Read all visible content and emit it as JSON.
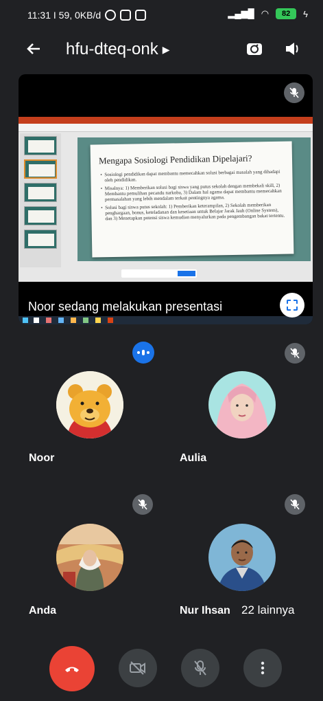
{
  "status_bar": {
    "time_info": "11:31 I 59, 0KB/d",
    "battery": "82",
    "icons": [
      "whatsapp-icon",
      "instagram-icon",
      "shop-icon",
      "signal-icon",
      "wifi-icon",
      "battery-icon",
      "charging-icon"
    ]
  },
  "header": {
    "meeting_code": "hfu-dteq-onk",
    "icons": [
      "back-arrow-icon",
      "chevron-right-icon",
      "switch-camera-icon",
      "speaker-icon"
    ]
  },
  "presentation": {
    "caption": "Noor sedang melakukan presentasi",
    "slide": {
      "title": "Mengapa Sosiologi Pendidikan Dipelajari?",
      "bullets": [
        "Sosiologi pendidikan dapat membantu memecahkan solusi berbagai masalah yang dihadapi oleh pendidikan.",
        "Misalnya: 1) Memberikan solusi bagi siswa yang putus sekolah dengan membekali skill, 2) Membantu pemulihan pecandu narkoba, 3) Dalam hal agama dapat membantu memecahkan permasalahan yang lebih mendalam terkait pentingnya agama.",
        "Solusi bagi siswa putus sekolah: 1) Pemberikan keterampilan, 2) Sekolah memberikan penghargaan, bonus, keteladanan dan kesetiaan untuk Belajar Jarak Jauh (Online System), dan 3) Menetapkan potensi siswa kemudian menyalurkan pada pengembangan bakat tertentu."
      ]
    }
  },
  "participants": [
    {
      "name": "Noor",
      "speaking": true,
      "muted": false,
      "avatar": "winnie-the-pooh"
    },
    {
      "name": "Aulia",
      "speaking": false,
      "muted": true,
      "avatar": "woman-pink-hijab"
    },
    {
      "name": "Anda",
      "speaking": false,
      "muted": true,
      "avatar": "woman-hijab-mall"
    },
    {
      "name": "Nur Ihsan",
      "speaking": false,
      "muted": true,
      "avatar": "man-blue-shirt"
    }
  ],
  "more_participants": "22 lainnya",
  "controls": [
    "end-call-icon",
    "camera-off-icon",
    "mic-off-icon",
    "more-options-icon"
  ],
  "colors": {
    "background": "#202124",
    "end_call": "#ea4335",
    "accent": "#1a73e8",
    "battery": "#34c759"
  }
}
